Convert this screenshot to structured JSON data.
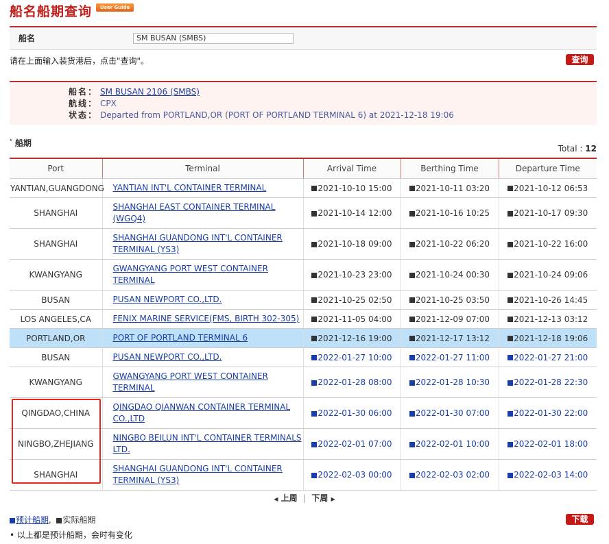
{
  "header": {
    "title": "船名船期查询",
    "guide_label": "User Guide"
  },
  "search": {
    "label": "船名",
    "value": "SM BUSAN (SMBS)",
    "hint": "请在上面输入装货港后，点击\"查询\"。",
    "query_button": "查询"
  },
  "info": {
    "vessel_key": "船名：",
    "vessel_val": "SM BUSAN 2106 (SMBS)",
    "route_key": "航线：",
    "route_val": "CPX",
    "status_key": "状态：",
    "status_val": "Departed from PORTLAND,OR (PORT OF PORTLAND TERMINAL 6) at 2021-12-18 19:06"
  },
  "schedule": {
    "title": "船期",
    "total_label": "Total : ",
    "total_value": "12",
    "columns": [
      "Port",
      "Terminal",
      "Arrival Time",
      "Berthing Time",
      "Departure Time"
    ],
    "rows": [
      {
        "port": "YANTIAN,GUANGDONG",
        "terminal": "YANTIAN INT'L CONTAINER TERMINAL",
        "arrival": "2021-10-10 15:00",
        "berthing": "2021-10-11 03:20",
        "departure": "2021-10-12 06:53",
        "actual": true
      },
      {
        "port": "SHANGHAI",
        "terminal": "SHANGHAI EAST CONTAINER TERMINAL (WGQ4)",
        "arrival": "2021-10-14 12:00",
        "berthing": "2021-10-16 10:25",
        "departure": "2021-10-17 09:30",
        "actual": true
      },
      {
        "port": "SHANGHAI",
        "terminal": "SHANGHAI GUANDONG INT'L CONTAINER TERMINAL (YS3)",
        "arrival": "2021-10-18 09:00",
        "berthing": "2021-10-22 06:20",
        "departure": "2021-10-22 16:00",
        "actual": true
      },
      {
        "port": "KWANGYANG",
        "terminal": "GWANGYANG PORT WEST CONTAINER TERMINAL",
        "arrival": "2021-10-23 23:00",
        "berthing": "2021-10-24 00:30",
        "departure": "2021-10-24 09:06",
        "actual": true
      },
      {
        "port": "BUSAN",
        "terminal": "PUSAN NEWPORT CO.,LTD.",
        "arrival": "2021-10-25 02:50",
        "berthing": "2021-10-25 03:50",
        "departure": "2021-10-26 14:45",
        "actual": true
      },
      {
        "port": "LOS ANGELES,CA",
        "terminal": "FENIX MARINE SERVICE(FMS, BIRTH 302-305)",
        "arrival": "2021-11-05 04:00",
        "berthing": "2021-12-09 07:00",
        "departure": "2021-12-13 03:12",
        "actual": true
      },
      {
        "port": "PORTLAND,OR",
        "terminal": "PORT OF PORTLAND TERMINAL 6",
        "arrival": "2021-12-16 19:00",
        "berthing": "2021-12-17 13:12",
        "departure": "2021-12-18 19:06",
        "actual": true,
        "highlight": true
      },
      {
        "port": "BUSAN",
        "terminal": "PUSAN NEWPORT CO.,LTD.",
        "arrival": "2022-01-27 10:00",
        "berthing": "2022-01-27 11:00",
        "departure": "2022-01-27 21:00",
        "actual": false
      },
      {
        "port": "KWANGYANG",
        "terminal": "GWANGYANG PORT WEST CONTAINER TERMINAL",
        "arrival": "2022-01-28 08:00",
        "berthing": "2022-01-28 10:30",
        "departure": "2022-01-28 22:30",
        "actual": false
      },
      {
        "port": "QINGDAO,CHINA",
        "terminal": "QINGDAO QIANWAN CONTAINER TERMINAL CO.,LTD",
        "arrival": "2022-01-30 06:00",
        "berthing": "2022-01-30 07:00",
        "departure": "2022-01-30 22:00",
        "actual": false
      },
      {
        "port": "NINGBO,ZHEJIANG",
        "terminal": "NINGBO BEILUN INT'L CONTAINER TERMINALS LTD.",
        "arrival": "2022-02-01 07:00",
        "berthing": "2022-02-01 10:00",
        "departure": "2022-02-01 18:00",
        "actual": false
      },
      {
        "port": "SHANGHAI",
        "terminal": "SHANGHAI GUANDONG INT'L CONTAINER TERMINAL (YS3)",
        "arrival": "2022-02-03 00:00",
        "berthing": "2022-02-03 02:00",
        "departure": "2022-02-03 14:00",
        "actual": false
      }
    ]
  },
  "pager": {
    "prev": "上周",
    "separator": "|",
    "next": "下周"
  },
  "legend": {
    "estimated": "预计船期",
    "comma": ",",
    "actual": "实际船期",
    "download_button": "下载"
  },
  "note": "以上都是预计船期，会时有变化",
  "colors": {
    "accent": "#c41a16",
    "link": "#1a3ea8",
    "highlight": "#bee0f8",
    "outline": "#e8261e"
  }
}
